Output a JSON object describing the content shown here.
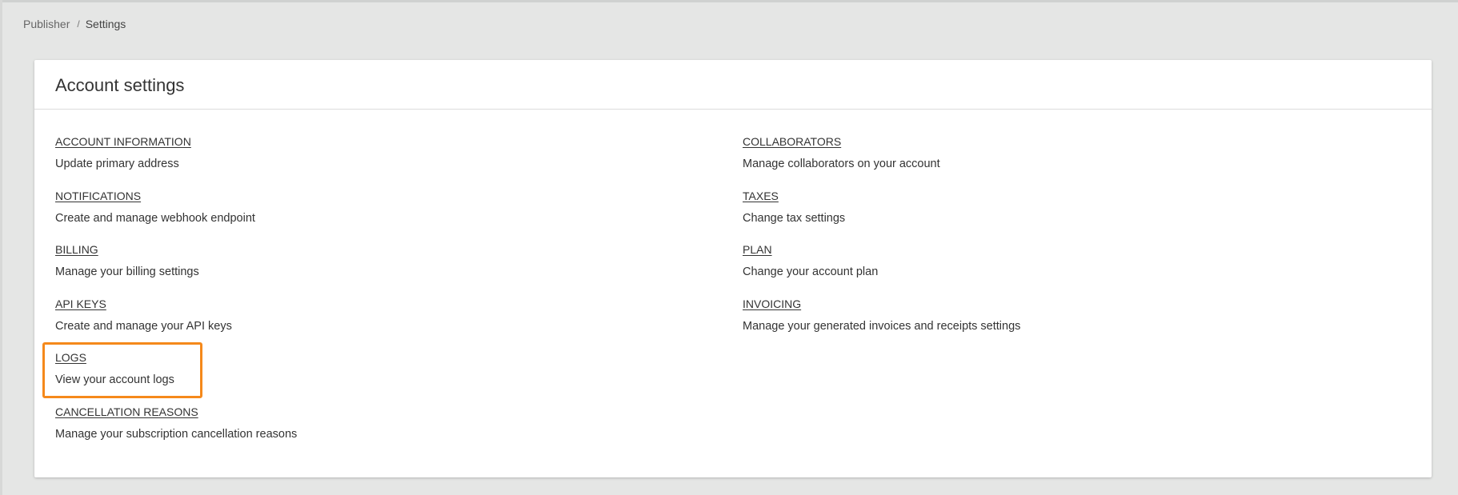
{
  "breadcrumb": {
    "root": "Publisher",
    "separator": "/",
    "current": "Settings"
  },
  "card": {
    "title": "Account settings"
  },
  "left_items": [
    {
      "label": "ACCOUNT INFORMATION",
      "description": "Update primary address"
    },
    {
      "label": "NOTIFICATIONS",
      "description": "Create and manage webhook endpoint"
    },
    {
      "label": "BILLING",
      "description": "Manage your billing settings"
    },
    {
      "label": "API KEYS",
      "description": "Create and manage your API keys"
    },
    {
      "label": "LOGS",
      "description": "View your account logs"
    },
    {
      "label": "CANCELLATION REASONS",
      "description": "Manage your subscription cancellation reasons"
    }
  ],
  "right_items": [
    {
      "label": "COLLABORATORS",
      "description": "Manage collaborators on your account"
    },
    {
      "label": "TAXES",
      "description": "Change tax settings"
    },
    {
      "label": "PLAN",
      "description": "Change your account plan"
    },
    {
      "label": "INVOICING",
      "description": "Manage your generated invoices and receipts settings"
    }
  ],
  "colors": {
    "background": "#e5e6e5",
    "card": "#ffffff",
    "text": "#333333",
    "highlight": "#f5891b"
  }
}
